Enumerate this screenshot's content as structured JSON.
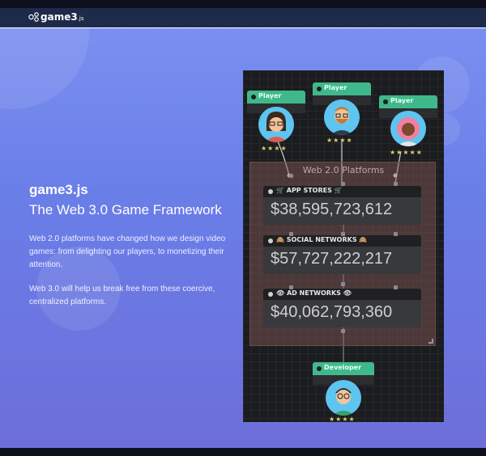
{
  "nav": {
    "logo_text": "game3",
    "logo_suffix": ".js"
  },
  "hero": {
    "title": "game3.js",
    "subtitle": "The Web 3.0 Game Framework",
    "paragraph1": "Web 2.0 platforms have changed how we design video games: from delighting our players, to monetizing their attention.",
    "paragraph2": "Web 3.0 will help us break free from these coercive, centralized platforms."
  },
  "diagram": {
    "group_title": "Web 2.0 Platforms",
    "players": [
      {
        "label": "Player",
        "stars": "★★★★"
      },
      {
        "label": "Player",
        "stars": "★★★★"
      },
      {
        "label": "Player",
        "stars": "★★★★★"
      }
    ],
    "nodes": [
      {
        "label": "🛒 APP STORES 🛒",
        "value": "$38,595,723,612"
      },
      {
        "label": "🙈 SOCIAL NETWORKS 🙈",
        "value": "$57,727,222,217"
      },
      {
        "label": "👁 AD NETWORKS 👁",
        "value": "$40,062,793,360"
      }
    ],
    "developer": {
      "label": "Developer",
      "stars": "★★★★"
    }
  },
  "colors": {
    "accent_green": "#3fb98b",
    "hero_top": "#7a8ff0",
    "hero_bottom": "#6d6ed9",
    "nav_bg": "#1e2a4a"
  }
}
